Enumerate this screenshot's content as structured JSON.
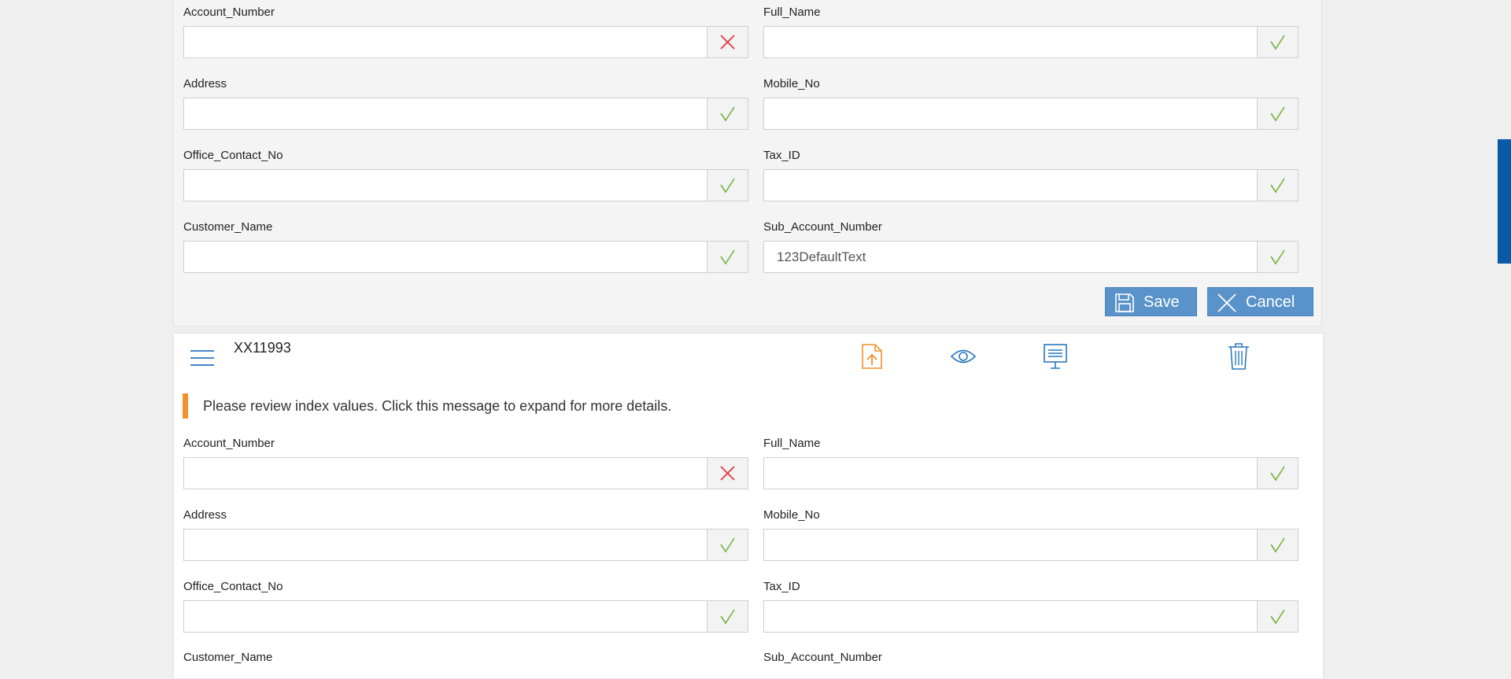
{
  "top_form": {
    "fields": {
      "account_number": {
        "label": "Account_Number",
        "value": "",
        "status": "invalid"
      },
      "full_name": {
        "label": "Full_Name",
        "value": "",
        "status": "valid"
      },
      "address": {
        "label": "Address",
        "value": "",
        "status": "valid"
      },
      "mobile_no": {
        "label": "Mobile_No",
        "value": "",
        "status": "valid"
      },
      "office_contact_no": {
        "label": "Office_Contact_No",
        "value": "",
        "status": "valid"
      },
      "tax_id": {
        "label": "Tax_ID",
        "value": "",
        "status": "valid"
      },
      "customer_name": {
        "label": "Customer_Name",
        "value": "",
        "status": "valid"
      },
      "sub_account_number": {
        "label": "Sub_Account_Number",
        "value": "123DefaultText",
        "status": "valid"
      }
    },
    "save_label": "Save",
    "cancel_label": "Cancel"
  },
  "document": {
    "title": "XX11993",
    "toolbar_icons": [
      "upload-file-icon",
      "eye-icon",
      "presentation-icon",
      "trash-icon"
    ],
    "notice": "Please review index values. Click this message to expand for more details.",
    "fields": {
      "account_number": {
        "label": "Account_Number",
        "value": "",
        "status": "invalid"
      },
      "full_name": {
        "label": "Full_Name",
        "value": "",
        "status": "valid"
      },
      "address": {
        "label": "Address",
        "value": "",
        "status": "valid"
      },
      "mobile_no": {
        "label": "Mobile_No",
        "value": "",
        "status": "valid"
      },
      "office_contact_no": {
        "label": "Office_Contact_No",
        "value": "",
        "status": "valid"
      },
      "tax_id": {
        "label": "Tax_ID",
        "value": "",
        "status": "valid"
      },
      "customer_name": {
        "label": "Customer_Name"
      },
      "sub_account_number": {
        "label": "Sub_Account_Number"
      }
    }
  },
  "colors": {
    "accent_blue": "#0a5aa8",
    "button_blue": "#5a93c9",
    "valid_green": "#76b043",
    "invalid_red": "#e0393e",
    "notice_orange": "#f0922b",
    "icon_orange": "#f0922b",
    "icon_blue": "#2a76c0"
  }
}
